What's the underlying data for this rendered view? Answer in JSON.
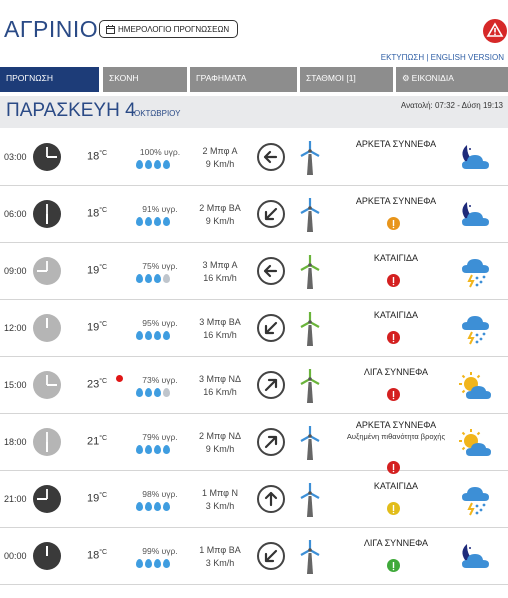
{
  "header": {
    "city": "ΑΓΡΙΝΙΟ",
    "calendar_button": "ΗΜΕΡΟΛΟΓΙΟ ΠΡΟΓΝΩΣΕΩΝ",
    "print_link": "ΕΚΤΥΠΩΣΗ",
    "separator": " | ",
    "english_link": "ENGLISH VERSION"
  },
  "tabs": [
    {
      "label": "ΠΡΟΓΝΩΣΗ",
      "active": true
    },
    {
      "label": "ΣΚΟΝΗ",
      "active": false
    },
    {
      "label": "ΓΡΑΦΗΜΑΤΑ",
      "active": false
    },
    {
      "label": "ΣΤΑΘΜΟΙ [1]",
      "active": false
    },
    {
      "label": "ΕΙΚΟΝΙΔΙΑ",
      "active": false
    }
  ],
  "day": {
    "name": "ΠΑΡΑΣΚΕΥΗ 4",
    "month": "ΟΚΤΩΒΡΙΟΥ",
    "sunrise_sunset": "Ανατολή: 07:32 - Δύση 19:13"
  },
  "colors": {
    "accent": "#1d3c78",
    "tab_inactive": "#8d8d8d",
    "drop": "#3f9de0",
    "alert": "#d62828"
  },
  "forecast": [
    {
      "time": "03:00",
      "clock": "dark",
      "temp": "18",
      "unit": "°C",
      "hot": false,
      "humidity": "100% υγρ.",
      "drops": 4,
      "wind": "2 Μπφ Α",
      "speed": "9 Km/h",
      "arrow_dir": "west",
      "turbine": "blue",
      "condition": "ΑΡΚΕΤΑ ΣΥΝΝΕΦΑ",
      "note": "",
      "badge": "",
      "icon": "night-cloud-icon"
    },
    {
      "time": "06:00",
      "clock": "dark",
      "temp": "18",
      "unit": "°C",
      "hot": false,
      "humidity": "91% υγρ.",
      "drops": 4,
      "wind": "2 Μπφ ΒΑ",
      "speed": "9 Km/h",
      "arrow_dir": "southwest",
      "turbine": "blue",
      "condition": "ΑΡΚΕΤΑ ΣΥΝΝΕΦΑ",
      "note": "",
      "badge": "orange",
      "icon": "night-cloud-icon"
    },
    {
      "time": "09:00",
      "clock": "light",
      "temp": "19",
      "unit": "°C",
      "hot": false,
      "humidity": "75% υγρ.",
      "drops": 3,
      "wind": "3 Μπφ Α",
      "speed": "16 Km/h",
      "arrow_dir": "west",
      "turbine": "green",
      "condition": "ΚΑΤΑΙΓΙΔΑ",
      "note": "",
      "badge": "red",
      "icon": "thunderstorm-icon"
    },
    {
      "time": "12:00",
      "clock": "light",
      "temp": "19",
      "unit": "°C",
      "hot": false,
      "humidity": "95% υγρ.",
      "drops": 4,
      "wind": "3 Μπφ ΒΑ",
      "speed": "16 Km/h",
      "arrow_dir": "southwest",
      "turbine": "green",
      "condition": "ΚΑΤΑΙΓΙΔΑ",
      "note": "",
      "badge": "red",
      "icon": "thunderstorm-icon"
    },
    {
      "time": "15:00",
      "clock": "light",
      "temp": "23",
      "unit": "°C",
      "hot": true,
      "humidity": "73% υγρ.",
      "drops": 3,
      "wind": "3 Μπφ ΝΔ",
      "speed": "16 Km/h",
      "arrow_dir": "northeast",
      "turbine": "green",
      "condition": "ΛΙΓΑ ΣΥΝΝΕΦΑ",
      "note": "",
      "badge": "red",
      "icon": "sun-cloud-icon"
    },
    {
      "time": "18:00",
      "clock": "light",
      "temp": "21",
      "unit": "°C",
      "hot": false,
      "humidity": "79% υγρ.",
      "drops": 4,
      "wind": "2 Μπφ ΝΔ",
      "speed": "9 Km/h",
      "arrow_dir": "northeast",
      "turbine": "blue",
      "condition": "ΑΡΚΕΤΑ ΣΥΝΝΕΦΑ",
      "note": "Αυξημένη πιθανότητα βροχής",
      "badge": "red",
      "icon": "sun-cloud-icon"
    },
    {
      "time": "21:00",
      "clock": "dark",
      "temp": "19",
      "unit": "°C",
      "hot": false,
      "humidity": "98% υγρ.",
      "drops": 4,
      "wind": "1 Μπφ Ν",
      "speed": "3 Km/h",
      "arrow_dir": "north",
      "turbine": "blue",
      "condition": "ΚΑΤΑΙΓΙΔΑ",
      "note": "",
      "badge": "yellow",
      "icon": "storm-rain-icon"
    },
    {
      "time": "00:00",
      "clock": "dark",
      "temp": "18",
      "unit": "°C",
      "hot": false,
      "humidity": "99% υγρ.",
      "drops": 4,
      "wind": "1 Μπφ ΒΑ",
      "speed": "3 Km/h",
      "arrow_dir": "southwest",
      "turbine": "blue",
      "condition": "ΛΙΓΑ ΣΥΝΝΕΦΑ",
      "note": "",
      "badge": "green",
      "icon": "night-cloud-icon"
    }
  ]
}
